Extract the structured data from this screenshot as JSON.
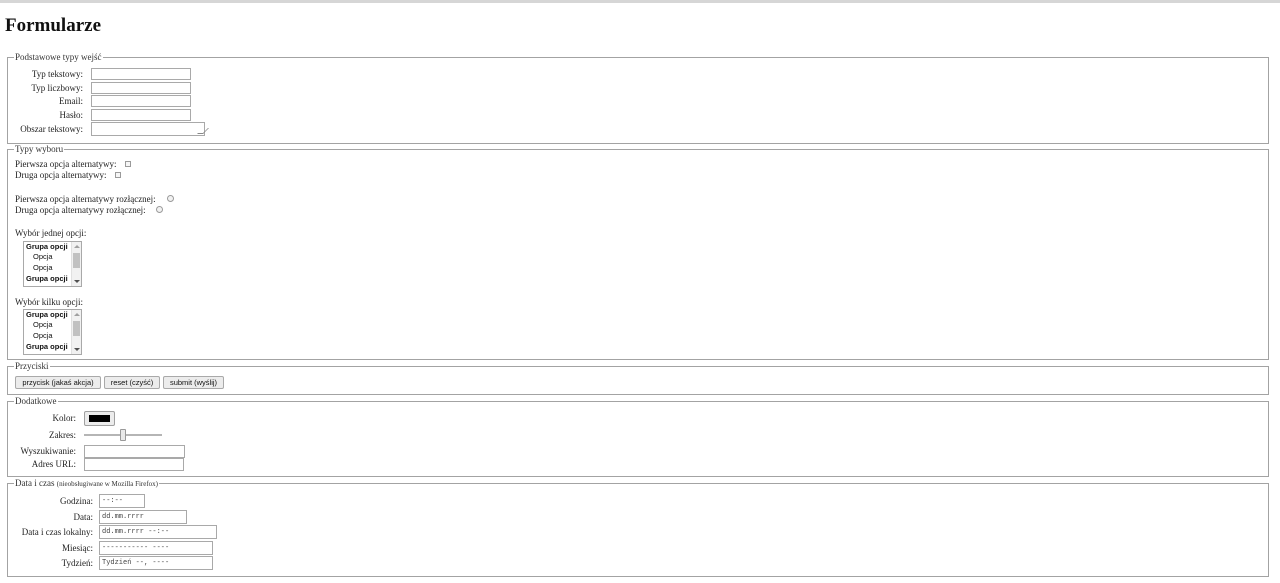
{
  "page": {
    "title": "Formularze"
  },
  "basic": {
    "legend": "Podstawowe typy wejść",
    "text_label": "Typ tekstowy:",
    "number_label": "Typ liczbowy:",
    "email_label": "Email:",
    "password_label": "Hasło:",
    "textarea_label": "Obszar tekstowy:"
  },
  "choice": {
    "legend": "Typy wyboru",
    "checkbox1_label": "Pierwsza opcja alternatywy:",
    "checkbox2_label": "Druga opcja alternatywy:",
    "radio1_label": "Pierwsza opcja alternatywy rozłącznej:",
    "radio2_label": "Druga opcja alternatywy rozłącznej:",
    "single_select_label": "Wybór jednej opcji:",
    "multi_select_label": "Wybór kilku opcji:",
    "select_rows": [
      "Grupa opcji",
      "Opcja",
      "Opcja",
      "Grupa opcji"
    ]
  },
  "buttons": {
    "legend": "Przyciski",
    "button_label": "przycisk (jakaś akcja)",
    "reset_label": "reset (czyść)",
    "submit_label": "submit (wyślij)"
  },
  "extra": {
    "legend": "Dodatkowe",
    "color_label": "Kolor:",
    "color_value": "#000000",
    "range_label": "Zakres:",
    "range_value": 0.5,
    "search_label": "Wyszukiwanie:",
    "url_label": "Adres URL:"
  },
  "datetime": {
    "legend": "Data i czas",
    "legend_note": "(nieobsługiwane w Mozilla Firefox)",
    "time_label": "Godzina:",
    "time_placeholder": "--:--",
    "date_label": "Data:",
    "date_placeholder": "dd.mm.rrrr",
    "local_label": "Data i czas lokalny:",
    "local_placeholder": "dd.mm.rrrr --:--",
    "month_label": "Miesiąc:",
    "month_placeholder": "----------- ----",
    "week_label": "Tydzień:",
    "week_placeholder": "Tydzień --, ----"
  }
}
